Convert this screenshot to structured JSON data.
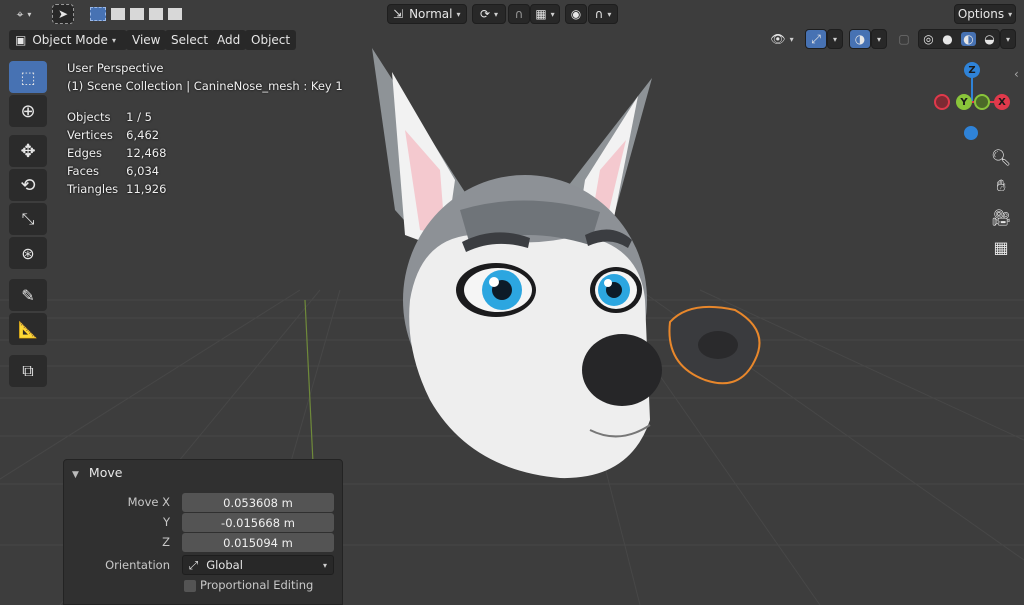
{
  "header": {
    "editor_type_icon": "viewport-editor-icon",
    "transform_orientation": "Normal",
    "options_label": "Options"
  },
  "viewport_header": {
    "mode_label": "Object Mode",
    "menus": [
      "View",
      "Select",
      "Add",
      "Object"
    ]
  },
  "overlay_info": {
    "perspective": "User Perspective",
    "collection": "(1) Scene Collection | CanineNose_mesh : Key 1",
    "stats": [
      {
        "label": "Objects",
        "value": "1 / 5"
      },
      {
        "label": "Vertices",
        "value": "6,462"
      },
      {
        "label": "Edges",
        "value": "12,468"
      },
      {
        "label": "Faces",
        "value": "6,034"
      },
      {
        "label": "Triangles",
        "value": "11,926"
      }
    ]
  },
  "gizmo": {
    "z": "Z",
    "y": "Y",
    "x": "X",
    "x_color": "#e0394b",
    "y_color": "#89c53a",
    "z_color": "#2f83d8"
  },
  "operator_panel": {
    "title": "Move",
    "fields": [
      {
        "label": "Move X",
        "value": "0.053608 m"
      },
      {
        "label": "Y",
        "value": "-0.015668 m"
      },
      {
        "label": "Z",
        "value": "0.015094 m"
      }
    ],
    "orientation_label": "Orientation",
    "orientation_value": "Global",
    "proportional_label": "Proportional Editing"
  },
  "colors": {
    "accent": "#4772b3",
    "selection_outline": "#e8872b",
    "background": "#3d3d3d"
  }
}
